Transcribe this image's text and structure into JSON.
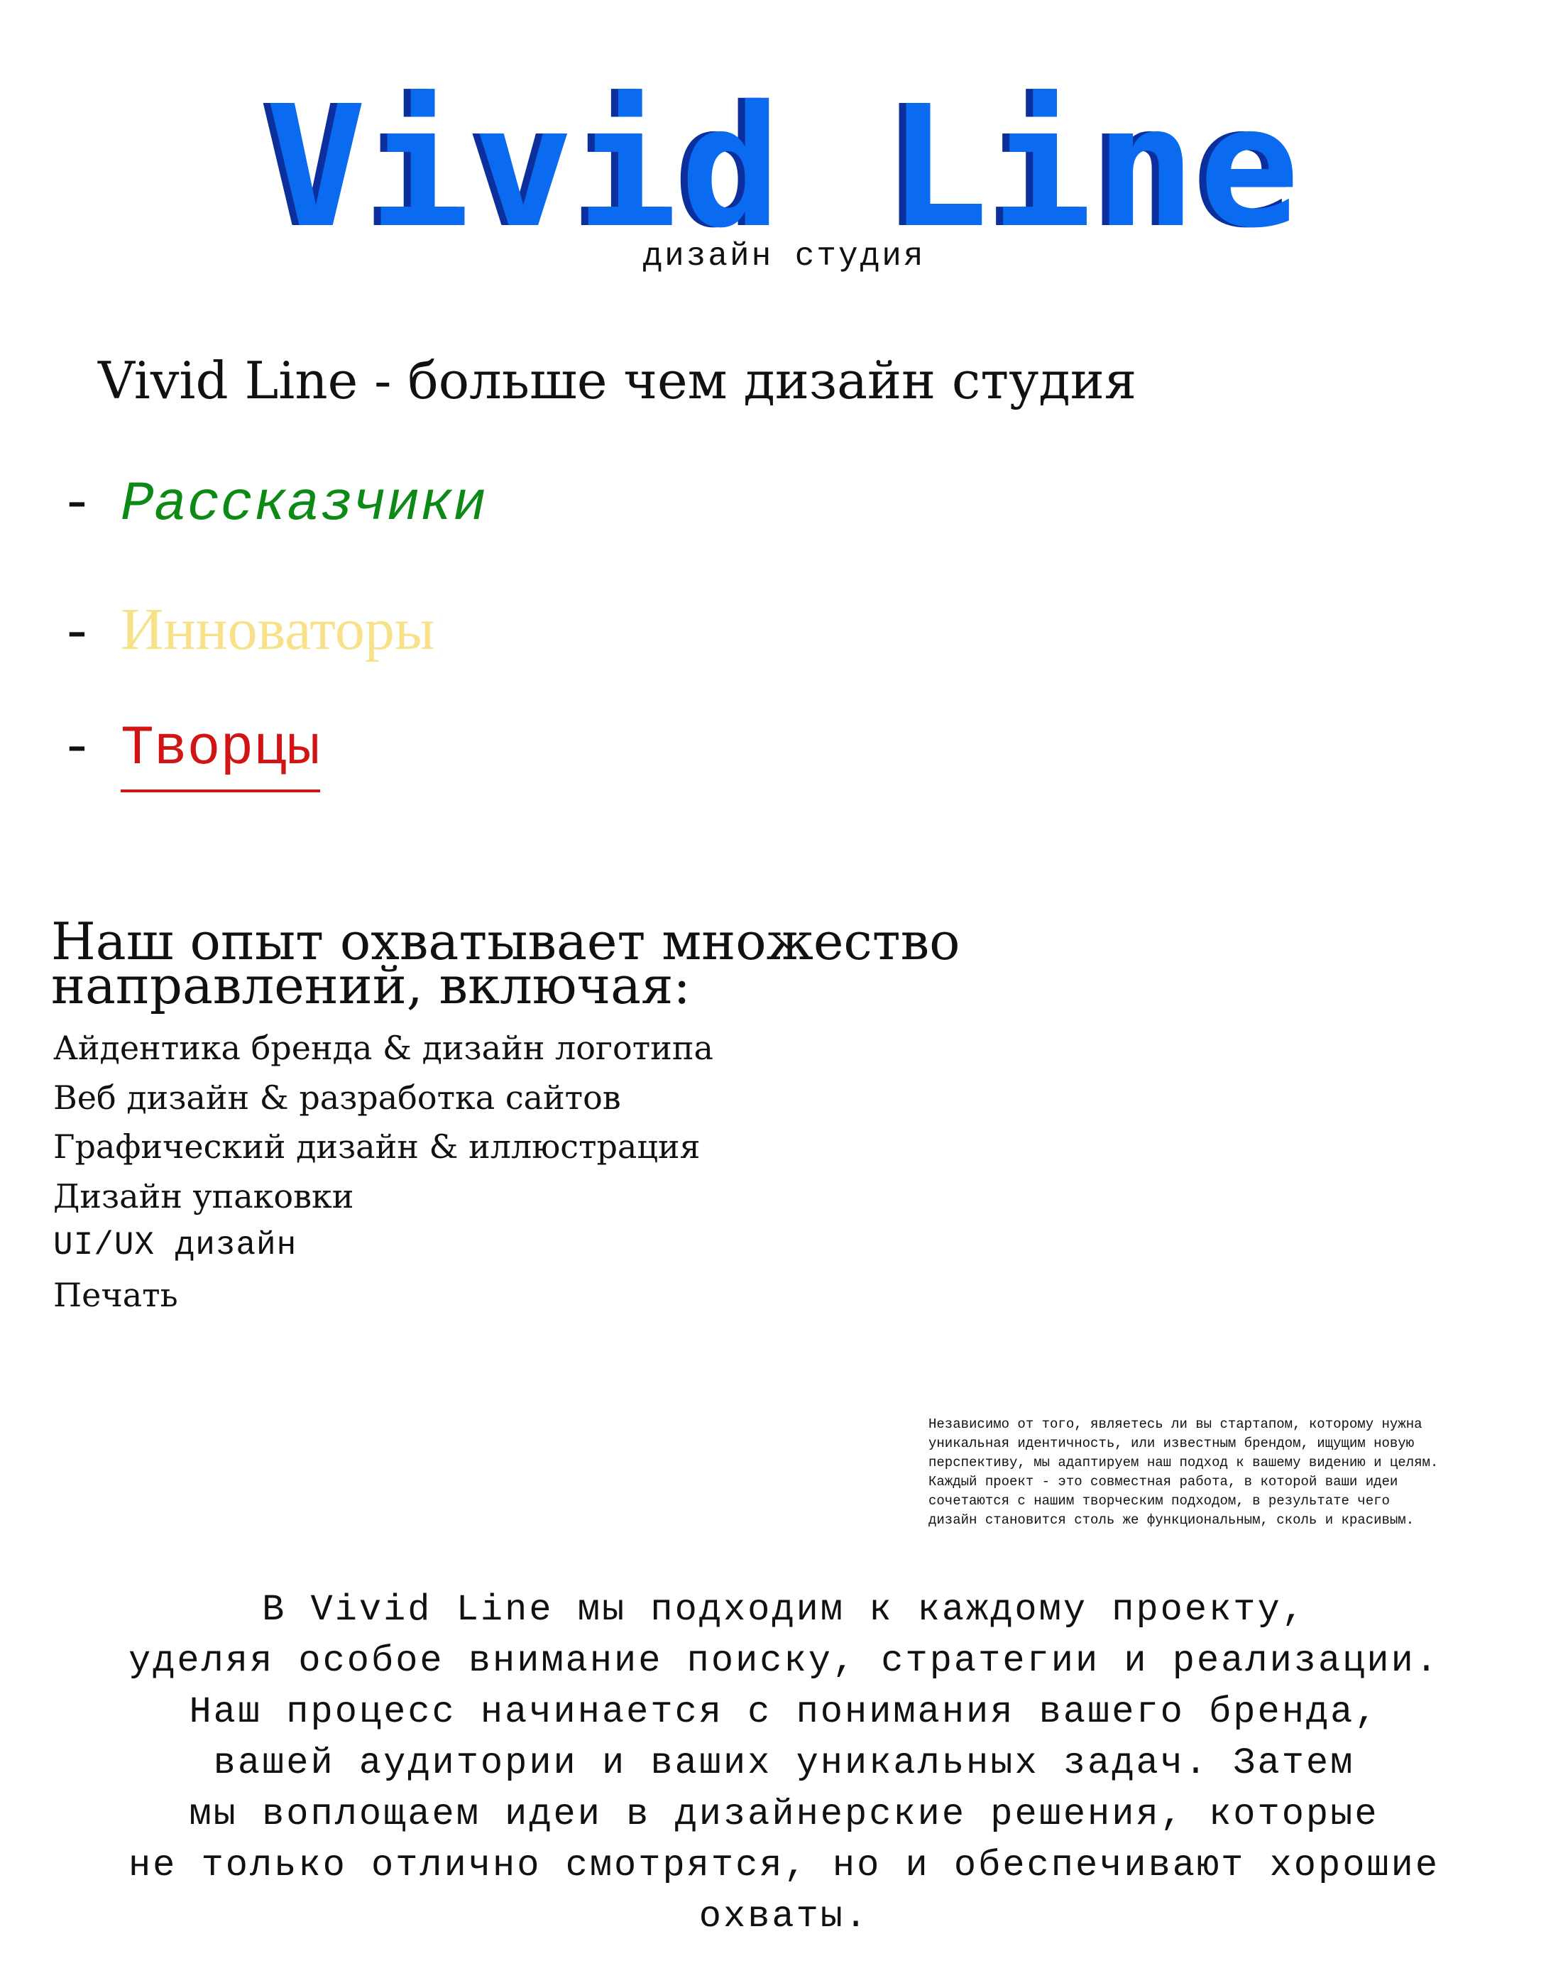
{
  "header": {
    "brand_title": "Vivid Line",
    "brand_subtitle": "дизайн студия",
    "colors": {
      "brand_front": "#0a6af0",
      "brand_shadow": "#0b2f9c"
    }
  },
  "intro": {
    "tagline": "Vivid Line - больше чем дизайн студия",
    "roles": [
      {
        "dash": "-",
        "label": "Рассказчики",
        "color": "#0d8a16"
      },
      {
        "dash": "-",
        "label": "Инноваторы",
        "color": "#f7e28a"
      },
      {
        "dash": "-",
        "label": "Творцы",
        "color": "#d11414"
      }
    ]
  },
  "experience": {
    "heading_line1": "Наш опыт охватывает множество",
    "heading_line2": "направлений, включая:",
    "services": [
      "Айдентика бренда & дизайн логотипа",
      "Веб дизайн & разработка сайтов",
      "Графический дизайн & иллюстрация",
      "Дизайн упаковки",
      "UI/UX дизайн",
      "Печать"
    ]
  },
  "note": {
    "lines": [
      "Независимо от того, являетесь ли вы стартапом, которому нужна",
      "уникальная идентичность, или известным брендом, ищущим новую",
      "перспективу, мы адаптируем наш подход к вашему видению и целям.",
      "Каждый проект - это совместная работа, в которой ваши идеи",
      "сочетаются с нашим творческим подходом, в результате чего",
      "дизайн становится столь же функциональным, сколь и красивым."
    ]
  },
  "process": {
    "lines": [
      "В Vivid Line мы подходим к каждому проекту,",
      "уделяя особое внимание поиску, стратегии и реализации.",
      "Наш процесс начинается с понимания вашего бренда,",
      "вашей аудитории и ваших уникальных задач. Затем",
      "мы воплощаем идеи в дизайнерские решения, которые",
      "не только отлично смотрятся, но и обеспечивают хорошие",
      "охваты."
    ]
  }
}
